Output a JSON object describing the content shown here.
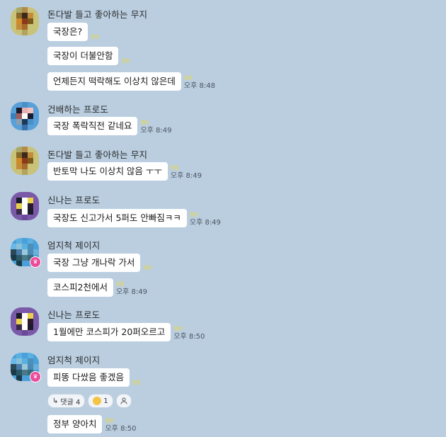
{
  "colors": {
    "background": "#bacee0",
    "bubble": "#ffffff",
    "unread": "#e8d84a",
    "crown": "#ec4a9a"
  },
  "groups": [
    {
      "sender": "돈다발 들고 좋아하는 무지",
      "avatar": "muzi-avatar",
      "messages": [
        {
          "text": "국장은?",
          "unread": "99",
          "time": ""
        },
        {
          "text": "국장이 더불안함",
          "unread": "99",
          "time": ""
        },
        {
          "text": "언제든지 떡락해도 이상치 않은데",
          "unread": "99",
          "time": "오후 8:48"
        }
      ]
    },
    {
      "sender": "건배하는 프로도",
      "avatar": "frodo-cheers-avatar",
      "messages": [
        {
          "text": "국장 폭락직전 같네요",
          "unread": "99",
          "time": "오후 8:49"
        }
      ]
    },
    {
      "sender": "돈다발 들고 좋아하는 무지",
      "avatar": "muzi-avatar",
      "messages": [
        {
          "text": "반토막 나도 이상치 않음 ㅜㅜ",
          "unread": "99",
          "time": "오후 8:49"
        }
      ]
    },
    {
      "sender": "신나는 프로도",
      "avatar": "frodo-excited-avatar",
      "messages": [
        {
          "text": "국장도 신고가서 5퍼도 안빠짐ㅋㅋ",
          "unread": "99",
          "time": "오후 8:49"
        }
      ]
    },
    {
      "sender": "엄지척 제이지",
      "avatar": "jay-g-avatar",
      "messages": [
        {
          "text": "국장 그냥 개나락 가서",
          "unread": "99",
          "time": ""
        },
        {
          "text": "코스피2천에서",
          "unread": "99",
          "time": "오후 8:49"
        }
      ]
    },
    {
      "sender": "신나는 프로도",
      "avatar": "frodo-excited-avatar",
      "messages": [
        {
          "text": "1월에만 코스피가 20퍼오르고",
          "unread": "99",
          "time": "오후 8:50"
        }
      ]
    },
    {
      "sender": "엄지척 제이지",
      "avatar": "jay-g-avatar",
      "messages": [
        {
          "text": "피똥 다쌌음 좋겠음",
          "unread": "99",
          "time": ""
        },
        {
          "text": "정부 양아치",
          "unread": "99",
          "time": "오후 8:50"
        }
      ],
      "reactions": {
        "reply_label": "댓글 4",
        "emoji_count": "1"
      }
    }
  ]
}
